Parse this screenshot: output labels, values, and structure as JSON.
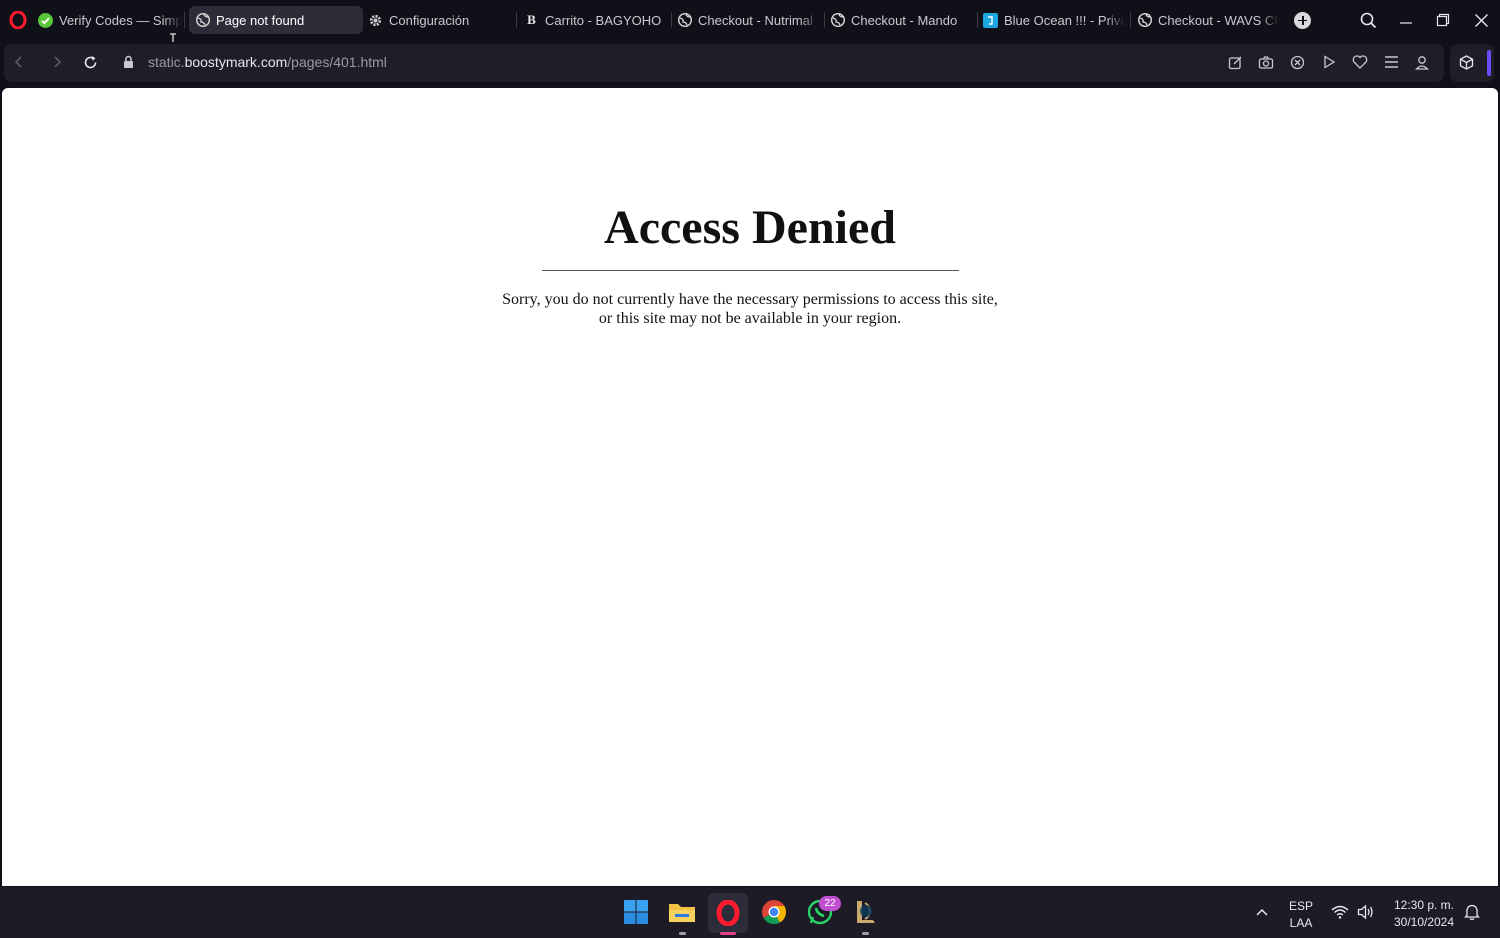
{
  "browser": {
    "tabs": [
      {
        "title": "Verify Codes — Simply",
        "icon": "check-circle-icon"
      },
      {
        "title": "Page not found",
        "icon": "globe-icon",
        "active": true
      },
      {
        "title": "Configuración",
        "icon": "gear-icon"
      },
      {
        "title": "Carrito - BAGYOHO",
        "icon": "letter-b-icon"
      },
      {
        "title": "Checkout - Nutrimal S",
        "icon": "globe-icon"
      },
      {
        "title": "Checkout - Mando",
        "icon": "globe-icon"
      },
      {
        "title": "Blue Ocean !!! - Private",
        "icon": "blue-square-icon"
      },
      {
        "title": "Checkout - WAVS CUS",
        "icon": "globe-icon"
      }
    ],
    "url_prefix": "static.",
    "url_host": "boostymark.com",
    "url_path": "/pages/401.html"
  },
  "page": {
    "heading": "Access Denied",
    "message_line1": "Sorry, you do not currently have the necessary permissions to access this site,",
    "message_line2": "or this site may not be available in your region."
  },
  "taskbar": {
    "whatsapp_badge": "22",
    "lang_top": "ESP",
    "lang_bottom": "LAA",
    "time": "12:30 p. m.",
    "date": "30/10/2024"
  },
  "colors": {
    "chrome_bg": "#101018",
    "address_pill": "#1d1e28",
    "active_tab": "#2c2d38",
    "accent": "#6b4cff",
    "page_bg": "#ffffff"
  }
}
